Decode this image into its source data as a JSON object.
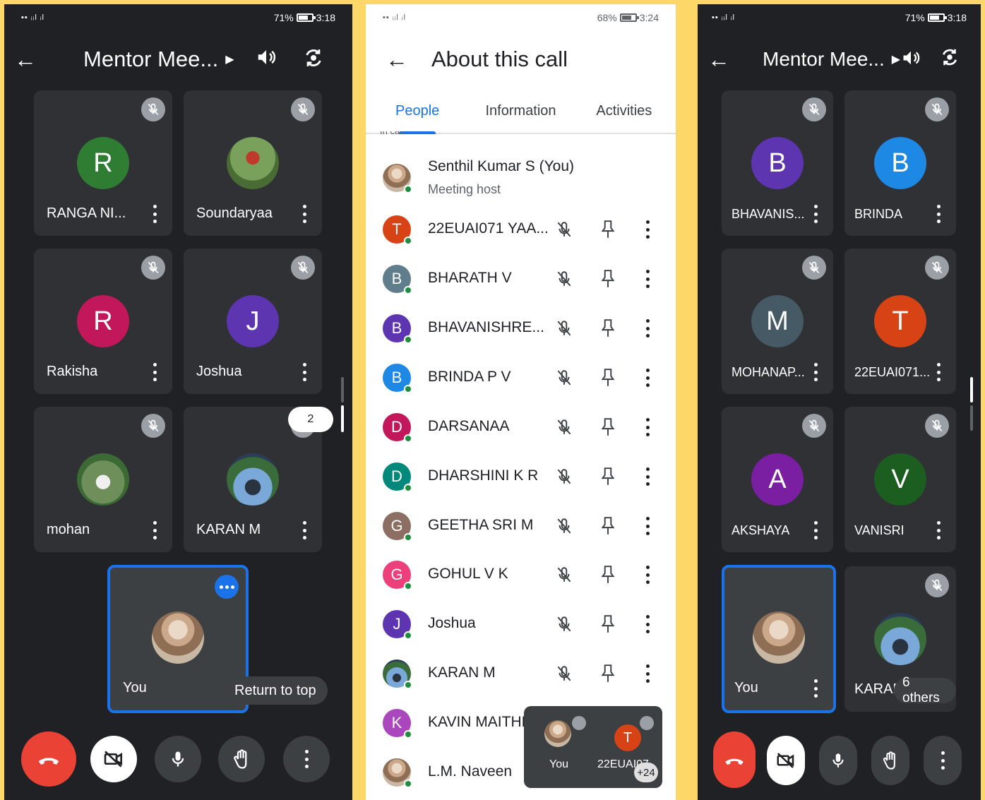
{
  "colors": {
    "background": "#fdd868",
    "dark_bg": "#202124",
    "tile": "#303134",
    "accent": "#1a73e8",
    "end_call": "#ea4335"
  },
  "left": {
    "status": {
      "battery": "71%",
      "time": "3:18"
    },
    "title": "Mentor Mee...",
    "tiles": [
      {
        "initial": "R",
        "name": "RANGA NI...",
        "color": "#2e7d32"
      },
      {
        "initial": "",
        "name": "Soundaryaa",
        "color": ""
      },
      {
        "initial": "R",
        "name": "Rakisha",
        "color": "#c2185b"
      },
      {
        "initial": "J",
        "name": "Joshua",
        "color": "#5e35b1"
      },
      {
        "initial": "",
        "name": "mohan",
        "color": ""
      },
      {
        "initial": "",
        "name": "KARAN M",
        "color": ""
      }
    ],
    "self_name": "You",
    "page_badge": "2",
    "return_to_top": "Return to top"
  },
  "middle": {
    "status": {
      "battery": "68%",
      "time": "3:24"
    },
    "title": "About this call",
    "tabs": [
      "People",
      "Information",
      "Activities"
    ],
    "section_cut": "In call",
    "host": {
      "name": "Senthil Kumar S (You)",
      "role": "Meeting host"
    },
    "people": [
      {
        "initial": "T",
        "name": "22EUAI071 YAA...",
        "color": "#d84315"
      },
      {
        "initial": "B",
        "name": "BHARATH V",
        "color": "#607d8b"
      },
      {
        "initial": "B",
        "name": "BHAVANISHRE...",
        "color": "#5e35b1"
      },
      {
        "initial": "B",
        "name": "BRINDA P V",
        "color": "#1e88e5"
      },
      {
        "initial": "D",
        "name": "DARSANAA",
        "color": "#c2185b"
      },
      {
        "initial": "D",
        "name": "DHARSHINI K R",
        "color": "#00897b"
      },
      {
        "initial": "G",
        "name": "GEETHA SRI M",
        "color": "#8d6e63"
      },
      {
        "initial": "G",
        "name": "GOHUL V K",
        "color": "#ec407a"
      },
      {
        "initial": "J",
        "name": "Joshua",
        "color": "#5e35b1"
      },
      {
        "initial": "",
        "name": "KARAN M",
        "color": ""
      },
      {
        "initial": "K",
        "name": "KAVIN MAITHR",
        "color": "#ab47bc"
      },
      {
        "initial": "",
        "name": "L.M. Naveen",
        "color": ""
      }
    ],
    "pip": {
      "self_label": "You",
      "other_initial": "T",
      "other_label": "22EUAI07",
      "more_count": "+24"
    }
  },
  "right": {
    "status": {
      "battery": "71%",
      "time": "3:18"
    },
    "title": "Mentor Mee...",
    "tiles": [
      {
        "initial": "B",
        "name": "BHAVANIS...",
        "color": "#5e35b1"
      },
      {
        "initial": "B",
        "name": "BRINDA",
        "color": "#1e88e5"
      },
      {
        "initial": "M",
        "name": "MOHANAP...",
        "color": "#455a64"
      },
      {
        "initial": "T",
        "name": "22EUAI071...",
        "color": "#d84315"
      },
      {
        "initial": "A",
        "name": "AKSHAYA",
        "color": "#7b1fa2"
      },
      {
        "initial": "V",
        "name": "VANISRI",
        "color": "#1b5e20"
      }
    ],
    "self_name": "You",
    "karan_name": "KARAN",
    "others_label": "6 others"
  }
}
